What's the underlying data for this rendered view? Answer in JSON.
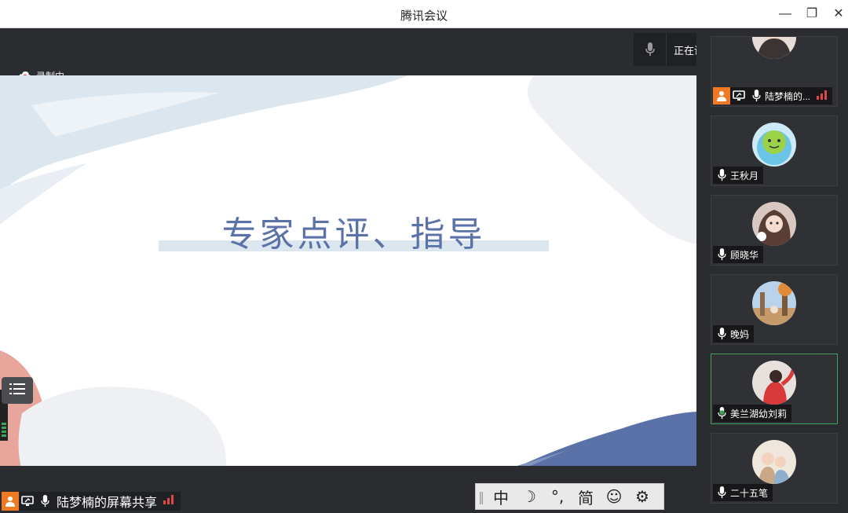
{
  "window": {
    "title": "腾讯会议",
    "minimize_label": "—",
    "restore_label": "❐",
    "close_label": "✕"
  },
  "recording": {
    "label": "录制中"
  },
  "speaking": {
    "label": "正在讲话: 美兰湖幼刘莉; 二十..."
  },
  "slide": {
    "heading": "专家点评、指导"
  },
  "participants": [
    {
      "name": "陆梦楠的...",
      "sharing": true
    },
    {
      "name": "王秋月"
    },
    {
      "name": "顾晓华"
    },
    {
      "name": "晚妈"
    },
    {
      "name": "美兰湖幼刘莉",
      "active": true
    },
    {
      "name": "二十五笔"
    }
  ],
  "share": {
    "label": "陆梦楠的屏幕共享"
  },
  "ime": {
    "items": [
      "中",
      "☽",
      "°,",
      "简",
      "☺",
      "⚙"
    ]
  },
  "colors": {
    "accent_orange": "#f07a23",
    "active_green": "#3da35a",
    "signal_red": "#e04848",
    "slide_blue": "#5a72a8",
    "slide_pink": "#e7a59b"
  }
}
